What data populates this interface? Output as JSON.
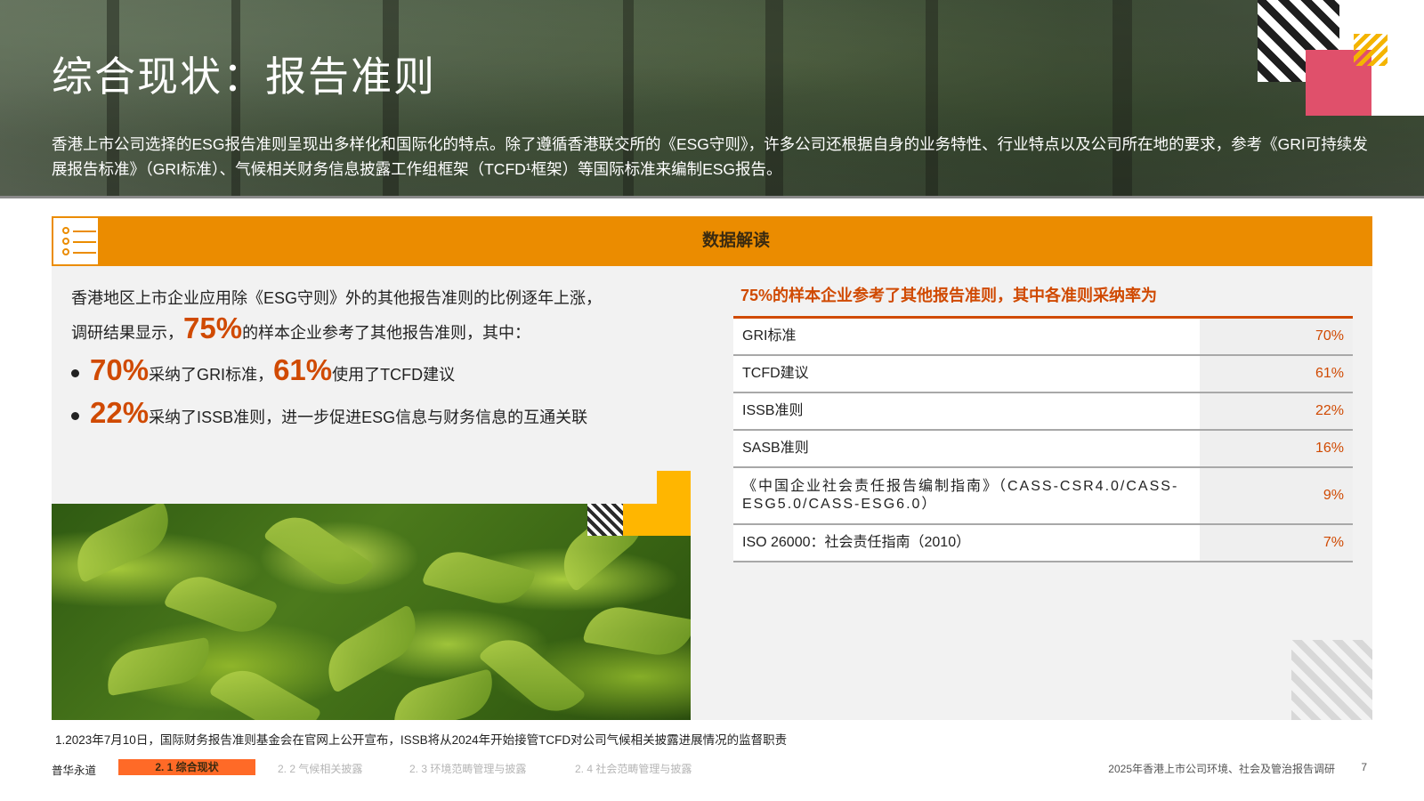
{
  "header": {
    "title": "综合现状：报告准则",
    "intro": "香港上市公司选择的ESG报告准则呈现出多样化和国际化的特点。除了遵循香港联交所的《ESG守则》，许多公司还根据自身的业务特性、行业特点以及公司所在地的要求，参考《GRI可持续发展报告标准》（GRI标准）、气候相关财务信息披露工作组框架（TCFD¹框架）等国际标准来编制ESG报告。"
  },
  "section": {
    "bar_title": "数据解读",
    "finding_line1": "香港地区上市企业应用除《ESG守则》外的其他报告准则的比例逐年上涨，",
    "finding_line2_prefix": "调研结果显示，",
    "finding_line2_big": "75%",
    "finding_line2_suffix": "的样本企业参考了其他报告准则，其中：",
    "bullets": [
      {
        "big1": "70%",
        "text1": "采纳了GRI标准，",
        "big2": "61%",
        "text2": "使用了TCFD建议"
      },
      {
        "big1": "22%",
        "text1": "采纳了ISSB准则，进一步促进ESG信息与财务信息的互通关联"
      }
    ]
  },
  "table": {
    "title": "75%的样本企业参考了其他报告准则，其中各准则采纳率为",
    "rows": [
      {
        "label": "GRI标准",
        "value": "70%"
      },
      {
        "label": "TCFD建议",
        "value": "61%"
      },
      {
        "label": "ISSB准则",
        "value": "22%"
      },
      {
        "label": "SASB准则",
        "value": "16%"
      },
      {
        "label": "《中国企业社会责任报告编制指南》（CASS-CSR4.0/CASS-ESG5.0/CASS-ESG6.0）",
        "value": "9%"
      },
      {
        "label": "ISO 26000：社会责任指南（2010）",
        "value": "7%"
      }
    ]
  },
  "footnote": "1.2023年7月10日，国际财务报告准则基金会在官网上公开宣布，ISSB将从2024年开始接管TCFD对公司气候相关披露进展情况的监督职责",
  "nav": {
    "brand": "普华永道",
    "active": "2. 1  综合现状",
    "items": [
      "2. 2  气候相关披露",
      "2. 3  环境范畴管理与披露",
      "2. 4  社会范畴管理与披露"
    ],
    "report": "2025年香港上市公司环境、社会及管治报告调研",
    "page": "7"
  },
  "colors": {
    "accent_orange": "#eb8c00",
    "highlight": "#d04a02",
    "pink": "#e0506b",
    "yellow": "#ffb600",
    "nav_active": "#ff6a27"
  }
}
